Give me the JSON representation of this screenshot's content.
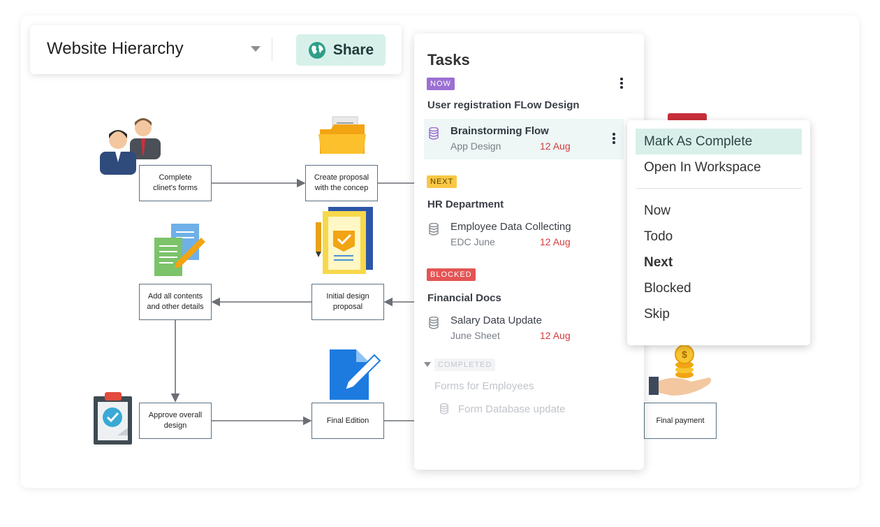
{
  "header": {
    "title": "Website Hierarchy",
    "share_label": "Share"
  },
  "diagram": {
    "nodes": {
      "complete_forms": "Complete\nclinet's forms",
      "create_proposal": "Create proposal\nwith the concep",
      "add_contents": "Add all contents\nand other details",
      "initial_design": "Initial design\nproposal",
      "approve_design": "Approve overall\ndesign",
      "final_edition": "Final Edition",
      "final_payment": "Final  payment"
    }
  },
  "tasks_panel": {
    "title": "Tasks",
    "groups": [
      {
        "badge": "NOW",
        "title": "User registration FLow Design",
        "tasks": [
          {
            "name": "Brainstorming Flow",
            "sub": "App Design",
            "date": "12 Aug"
          }
        ]
      },
      {
        "badge": "NEXT",
        "title": "HR Department",
        "tasks": [
          {
            "name": "Employee Data Collecting",
            "sub": "EDC June",
            "date": "12 Aug"
          }
        ]
      },
      {
        "badge": "BLOCKED",
        "title": "Financial Docs",
        "tasks": [
          {
            "name": "Salary Data Update",
            "sub": "June Sheet",
            "date": "12 Aug"
          }
        ]
      }
    ],
    "completed": {
      "badge": "COMPLETED",
      "title": "Forms for Employees",
      "task": "Form Database update"
    }
  },
  "context_menu": {
    "items": [
      "Mark As Complete",
      "Open In Workspace"
    ],
    "statuses": [
      "Now",
      "Todo",
      "Next",
      "Blocked",
      "Skip"
    ]
  },
  "colors": {
    "accent": "#d9efea",
    "now": "#9b6fd3",
    "next": "#f9c744",
    "blocked": "#e45454",
    "date": "#d23b3b"
  }
}
